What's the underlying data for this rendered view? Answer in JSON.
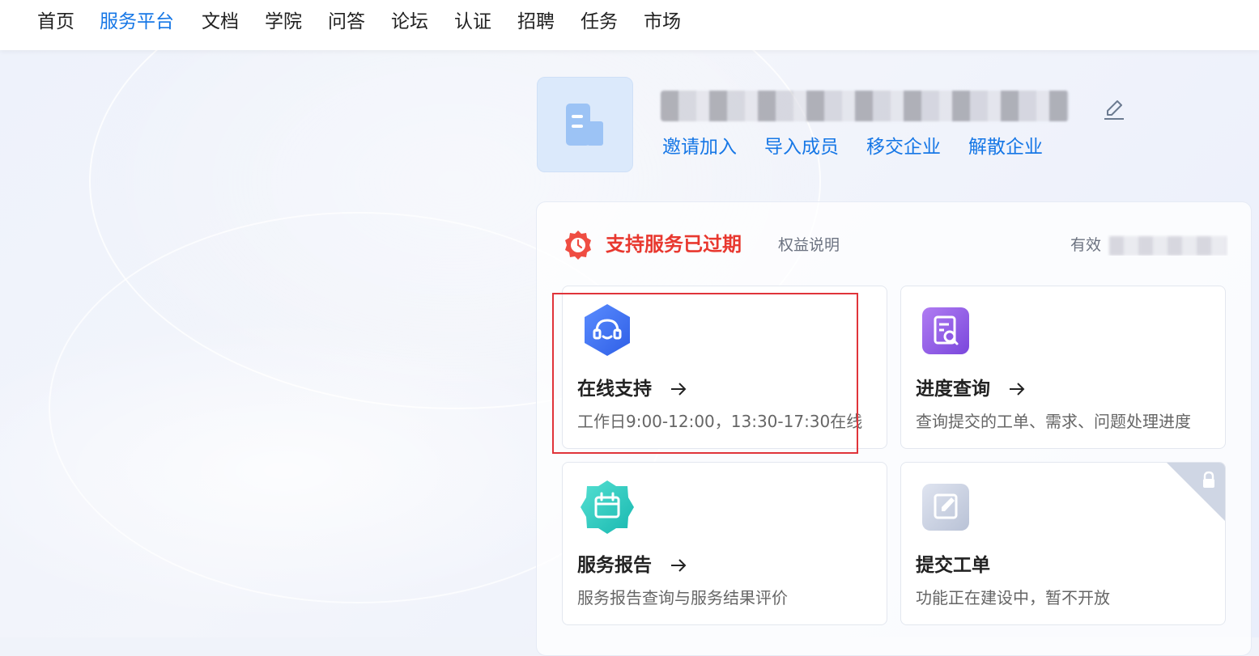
{
  "nav": {
    "items": [
      {
        "label": "首页",
        "active": false
      },
      {
        "label": "服务平台",
        "active": true
      },
      {
        "label": "文档",
        "active": false
      },
      {
        "label": "学院",
        "active": false
      },
      {
        "label": "问答",
        "active": false
      },
      {
        "label": "论坛",
        "active": false
      },
      {
        "label": "认证",
        "active": false
      },
      {
        "label": "招聘",
        "active": false
      },
      {
        "label": "任务",
        "active": false
      },
      {
        "label": "市场",
        "active": false
      }
    ],
    "active_color": "#1677e6"
  },
  "company": {
    "logo_icon": "building-icon",
    "name": "",
    "edit_icon": "pencil-icon",
    "actions": [
      "邀请加入",
      "导入成员",
      "移交企业",
      "解散企业"
    ]
  },
  "service": {
    "status_icon": "clock-badge-icon",
    "status": "支持服务已过期",
    "status_color": "#e8382f",
    "benefit_link": "权益说明",
    "validity_label": "有效",
    "cards": [
      {
        "icon": "headset-icon",
        "title": "在线支持",
        "desc": "工作日9:00-12:00，13:30-17:30在线",
        "locked": false
      },
      {
        "icon": "document-search-icon",
        "title": "进度查询",
        "desc": "查询提交的工单、需求、问题处理进度",
        "locked": false
      },
      {
        "icon": "calendar-icon",
        "title": "服务报告",
        "desc": "服务报告查询与服务结果评价",
        "locked": false
      },
      {
        "icon": "edit-document-icon",
        "title": "提交工单",
        "desc": "功能正在建设中，暂不开放",
        "locked": true
      }
    ]
  }
}
